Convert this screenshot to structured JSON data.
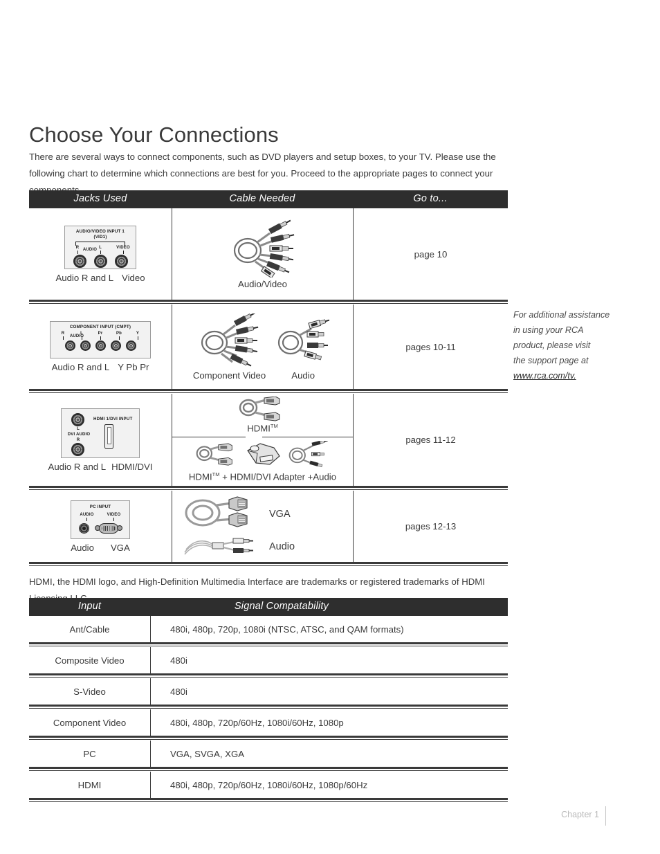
{
  "document": {
    "title": "Choose Your Connections",
    "intro": "There are several ways to connect components, such as DVD players and setup boxes, to your TV. Please use the following chart to determine which connections are best for you. Proceed to the appropriate pages to connect your components.",
    "trademark": "HDMI, the HDMI logo, and High-Definition Multimedia Interface are trademarks or registered trademarks of HDMI Licensing LLC."
  },
  "side_note": {
    "line1": "For additional assistance",
    "line2": "in using your RCA",
    "line3": "product, please visit",
    "line4": "the support page at",
    "link": "www.rca.com/tv."
  },
  "connections_table": {
    "headers": {
      "jacks": "Jacks Used",
      "cable": "Cable Needed",
      "goto": "Go to..."
    },
    "rows": [
      {
        "panel": {
          "title_line1": "AUDIO/VIDEO INPUT 1",
          "title_line2": "(VID1)",
          "labels": [
            "R",
            "AUDIO",
            "L",
            "VIDEO"
          ]
        },
        "jack_caption": [
          "Audio R and L",
          "Video"
        ],
        "cables": [
          {
            "label": "Audio/Video",
            "icon": "av-cable-icon"
          }
        ],
        "goto": "page 10"
      },
      {
        "panel": {
          "title_line1": "COMPONENT INPUT (CMPT)",
          "title_line2": "",
          "labels": [
            "R",
            "AUDIO",
            "L",
            "Pr",
            "Pb",
            "Y"
          ]
        },
        "jack_caption": [
          "Audio R and L",
          "Y Pb Pr"
        ],
        "cables": [
          {
            "label": "Component Video",
            "icon": "component-cable-icon"
          },
          {
            "label": "Audio",
            "icon": "audio-cable-icon"
          }
        ],
        "goto": "pages 10-11"
      },
      {
        "panel": {
          "title_line1": "HDMI 1/DVI INPUT",
          "title_line2": "DVI AUDIO",
          "labels": [
            "L",
            "R"
          ]
        },
        "jack_caption": [
          "Audio R and L",
          "HDMI/DVI"
        ],
        "cables_top": {
          "label": "HDMI",
          "tm": "TM",
          "icon": "hdmi-cable-icon"
        },
        "cables_bottom": {
          "part1": "HDMI",
          "tm": "TM",
          "plus1": "+",
          "part2": "HDMI/DVI Adapter",
          "plus2": "+",
          "part3": "Audio"
        },
        "goto": "pages 11-12"
      },
      {
        "panel": {
          "title_line1": "PC INPUT",
          "title_line2": "",
          "labels": [
            "AUDIO",
            "VIDEO"
          ]
        },
        "jack_caption": [
          "Audio",
          "VGA"
        ],
        "cables": [
          {
            "label": "VGA",
            "icon": "vga-cable-icon"
          },
          {
            "label": "Audio",
            "icon": "pc-audio-cable-icon"
          }
        ],
        "goto": "pages 12-13"
      }
    ]
  },
  "signal_table": {
    "headers": {
      "input": "Input",
      "compatibility": "Signal Compatability"
    },
    "rows": [
      {
        "input": "Ant/Cable",
        "value": "480i, 480p, 720p, 1080i (NTSC, ATSC, and QAM formats)"
      },
      {
        "input": "Composite Video",
        "value": "480i"
      },
      {
        "input": "S-Video",
        "value": "480i"
      },
      {
        "input": "Component  Video",
        "value": "480i, 480p, 720p/60Hz, 1080i/60Hz, 1080p"
      },
      {
        "input": "PC",
        "value": "VGA, SVGA, XGA"
      },
      {
        "input": "HDMI",
        "value": "480i, 480p, 720p/60Hz, 1080i/60Hz, 1080p/60Hz"
      }
    ]
  },
  "footer": {
    "chapter": "Chapter 1"
  },
  "colors": {
    "header_bg": "#2e2e2e",
    "rule": "#3a3a3a",
    "text": "#3a3a3a",
    "footer_text": "#b9b9b9"
  }
}
